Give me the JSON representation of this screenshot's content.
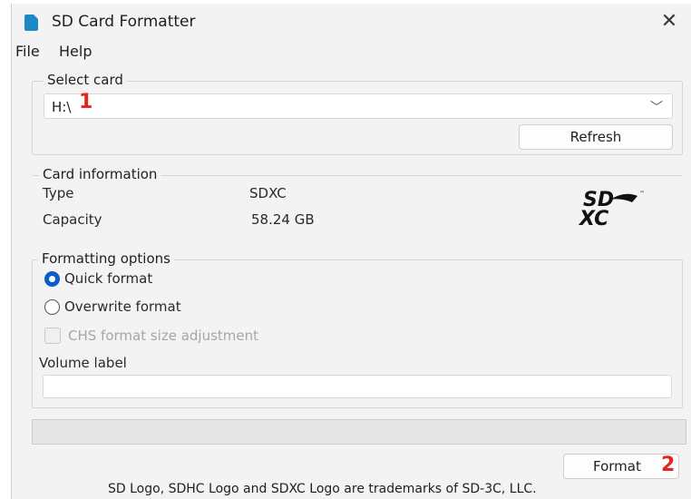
{
  "window": {
    "title": "SD Card Formatter",
    "close_glyph": "✕"
  },
  "menu": {
    "items": [
      "File",
      "Help"
    ]
  },
  "select_card": {
    "legend": "Select card",
    "value": "H:\\",
    "refresh_label": "Refresh"
  },
  "card_info": {
    "legend": "Card information",
    "type_label": "Type",
    "type_value": "SDXC",
    "capacity_label": "Capacity",
    "capacity_value": "58.24 GB",
    "logo_top": "SD",
    "logo_bottom": "XC"
  },
  "formatting": {
    "legend": "Formatting options",
    "quick_label": "Quick format",
    "quick_selected": true,
    "overwrite_label": "Overwrite format",
    "chs_label": "CHS format size adjustment",
    "volume_label": "Volume label",
    "volume_value": ""
  },
  "progress": 0,
  "format_label": "Format",
  "annotations": {
    "badge_1": "1",
    "badge_2": "2"
  },
  "footer": "SD Logo, SDHC Logo and SDXC Logo are trademarks of SD-3C, LLC.",
  "colors": {
    "accent": "#0a5ec9",
    "badge": "#e3261b",
    "app_icon": "#1e88c7"
  },
  "icons": {
    "app": "sd-card-app-icon",
    "close": "close-icon",
    "dropdown": "chevron-down-icon"
  }
}
